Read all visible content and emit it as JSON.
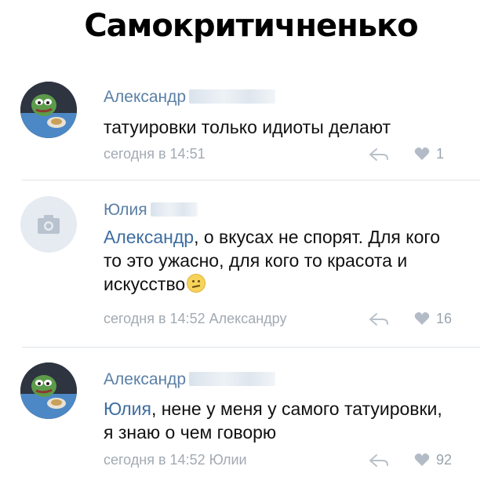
{
  "title": "Самокритичненько",
  "comments": [
    {
      "author": "Александр",
      "text": "татуировки только идиоты делают",
      "meta": "сегодня в 14:51",
      "likes": "1",
      "avatar": "pepe-avatar"
    },
    {
      "author": "Юлия",
      "mention": "Александр",
      "text": ", о вкусах не спорят. Для кого то это ужасно,  для кого то красота и искусство",
      "meta": "сегодня в 14:52 Александру",
      "likes": "16",
      "avatar": "camera-placeholder-avatar"
    },
    {
      "author": "Александр",
      "mention": "Юлия",
      "text": ", нене у меня у самого татуировки, я знаю о чем говорю",
      "meta": "сегодня в 14:52 Юлии",
      "likes": "92",
      "avatar": "pepe-avatar"
    }
  ],
  "colors": {
    "name": "#5b7fa6",
    "mention": "#3e6ea1",
    "meta": "#a2aab3",
    "divider": "#dfe3e8"
  }
}
